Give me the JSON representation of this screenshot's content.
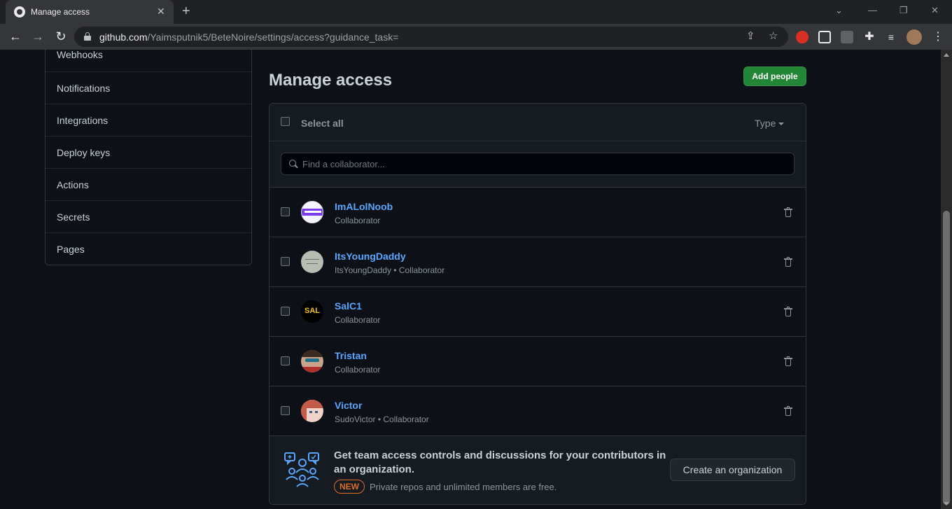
{
  "browser": {
    "tab_title": "Manage access",
    "url_host": "github.com",
    "url_path": "/Yaimsputnik5/BeteNoire/settings/access?guidance_task=",
    "new_tab_symbol": "+",
    "tab_close_symbol": "✕"
  },
  "sidebar": {
    "items": [
      {
        "label": "Webhooks"
      },
      {
        "label": "Notifications"
      },
      {
        "label": "Integrations"
      },
      {
        "label": "Deploy keys"
      },
      {
        "label": "Actions"
      },
      {
        "label": "Secrets"
      },
      {
        "label": "Pages"
      }
    ]
  },
  "main": {
    "title": "Manage access",
    "add_button": "Add people",
    "select_all": "Select all",
    "type_filter": "Type",
    "search_placeholder": "Find a collaborator...",
    "members": [
      {
        "name": "ImALolNoob",
        "sub": "Collaborator",
        "avatar": "purple-stripe-avatar"
      },
      {
        "name": "ItsYoungDaddy",
        "sub": "ItsYoungDaddy • Collaborator",
        "avatar": "gray-sketch-avatar"
      },
      {
        "name": "SalC1",
        "sub": "Collaborator",
        "avatar": "sal-logo-avatar",
        "avatar_text": "SAL"
      },
      {
        "name": "Tristan",
        "sub": "Collaborator",
        "avatar": "photo-avatar"
      },
      {
        "name": "Victor",
        "sub": "SudoVictor • Collaborator",
        "avatar": "anime-avatar"
      }
    ],
    "promo": {
      "title": "Get team access controls and discussions for your contributors in an organization.",
      "badge": "NEW",
      "note": "Private repos and unlimited members are free.",
      "button": "Create an organization"
    }
  },
  "colors": {
    "accent_green": "#238636",
    "link_blue": "#58a6ff",
    "badge_orange": "#db6d28",
    "promo_icon_blue": "#58a6ff"
  }
}
